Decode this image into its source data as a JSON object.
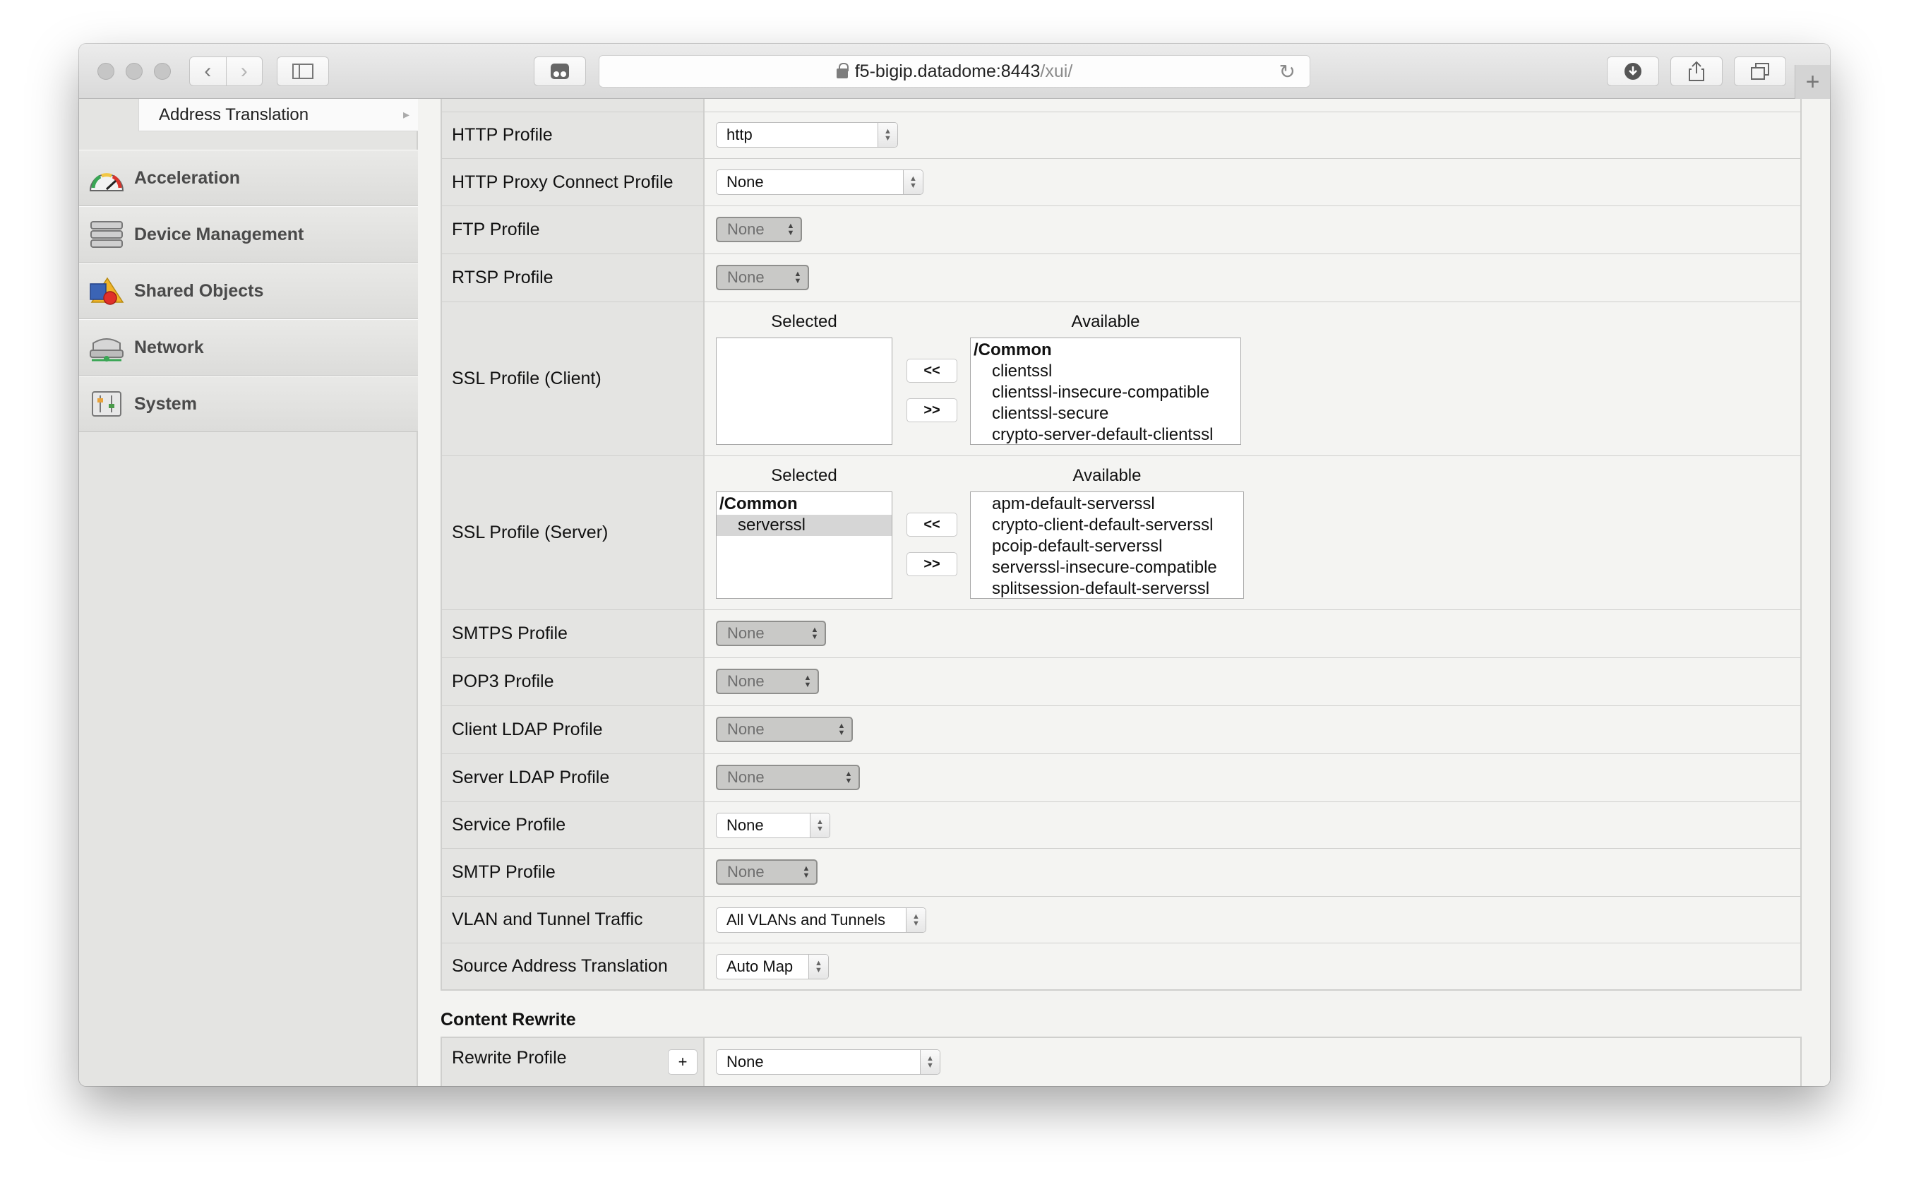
{
  "browser": {
    "url_host": "f5-bigip.datadome:8443",
    "url_path": "/xui/"
  },
  "sidebar": {
    "subitem": "Address Translation",
    "sections": [
      {
        "label": "Acceleration",
        "icon": "gauge-icon"
      },
      {
        "label": "Device Management",
        "icon": "server-stack-icon"
      },
      {
        "label": "Shared Objects",
        "icon": "shapes-icon"
      },
      {
        "label": "Network",
        "icon": "router-icon"
      },
      {
        "label": "System",
        "icon": "control-panel-icon"
      }
    ]
  },
  "config": {
    "http_profile": {
      "label": "HTTP Profile",
      "value": "http"
    },
    "http_proxy_connect": {
      "label": "HTTP Proxy Connect Profile",
      "value": "None"
    },
    "ftp_profile": {
      "label": "FTP Profile",
      "value": "None"
    },
    "rtsp_profile": {
      "label": "RTSP Profile",
      "value": "None"
    },
    "ssl_client": {
      "label": "SSL Profile (Client)",
      "selected_header": "Selected",
      "available_header": "Available",
      "available_group": "/Common",
      "available": [
        "clientssl",
        "clientssl-insecure-compatible",
        "clientssl-secure",
        "crypto-server-default-clientssl"
      ],
      "move_left": "<<",
      "move_right": ">>"
    },
    "ssl_server": {
      "label": "SSL Profile (Server)",
      "selected_header": "Selected",
      "available_header": "Available",
      "selected_group": "/Common",
      "selected": [
        "serverssl"
      ],
      "available": [
        "apm-default-serverssl",
        "crypto-client-default-serverssl",
        "pcoip-default-serverssl",
        "serverssl-insecure-compatible",
        "splitsession-default-serverssl"
      ],
      "move_left": "<<",
      "move_right": ">>"
    },
    "smtps_profile": {
      "label": "SMTPS Profile",
      "value": "None"
    },
    "pop3_profile": {
      "label": "POP3 Profile",
      "value": "None"
    },
    "client_ldap": {
      "label": "Client LDAP Profile",
      "value": "None"
    },
    "server_ldap": {
      "label": "Server LDAP Profile",
      "value": "None"
    },
    "service_profile": {
      "label": "Service Profile",
      "value": "None"
    },
    "smtp_profile": {
      "label": "SMTP Profile",
      "value": "None"
    },
    "vlan_traffic": {
      "label": "VLAN and Tunnel Traffic",
      "value": "All VLANs and Tunnels"
    },
    "source_nat": {
      "label": "Source Address Translation",
      "value": "Auto Map"
    }
  },
  "content_rewrite": {
    "title": "Content Rewrite",
    "rewrite_profile": {
      "label": "Rewrite Profile",
      "add": "+",
      "value": "None"
    }
  }
}
